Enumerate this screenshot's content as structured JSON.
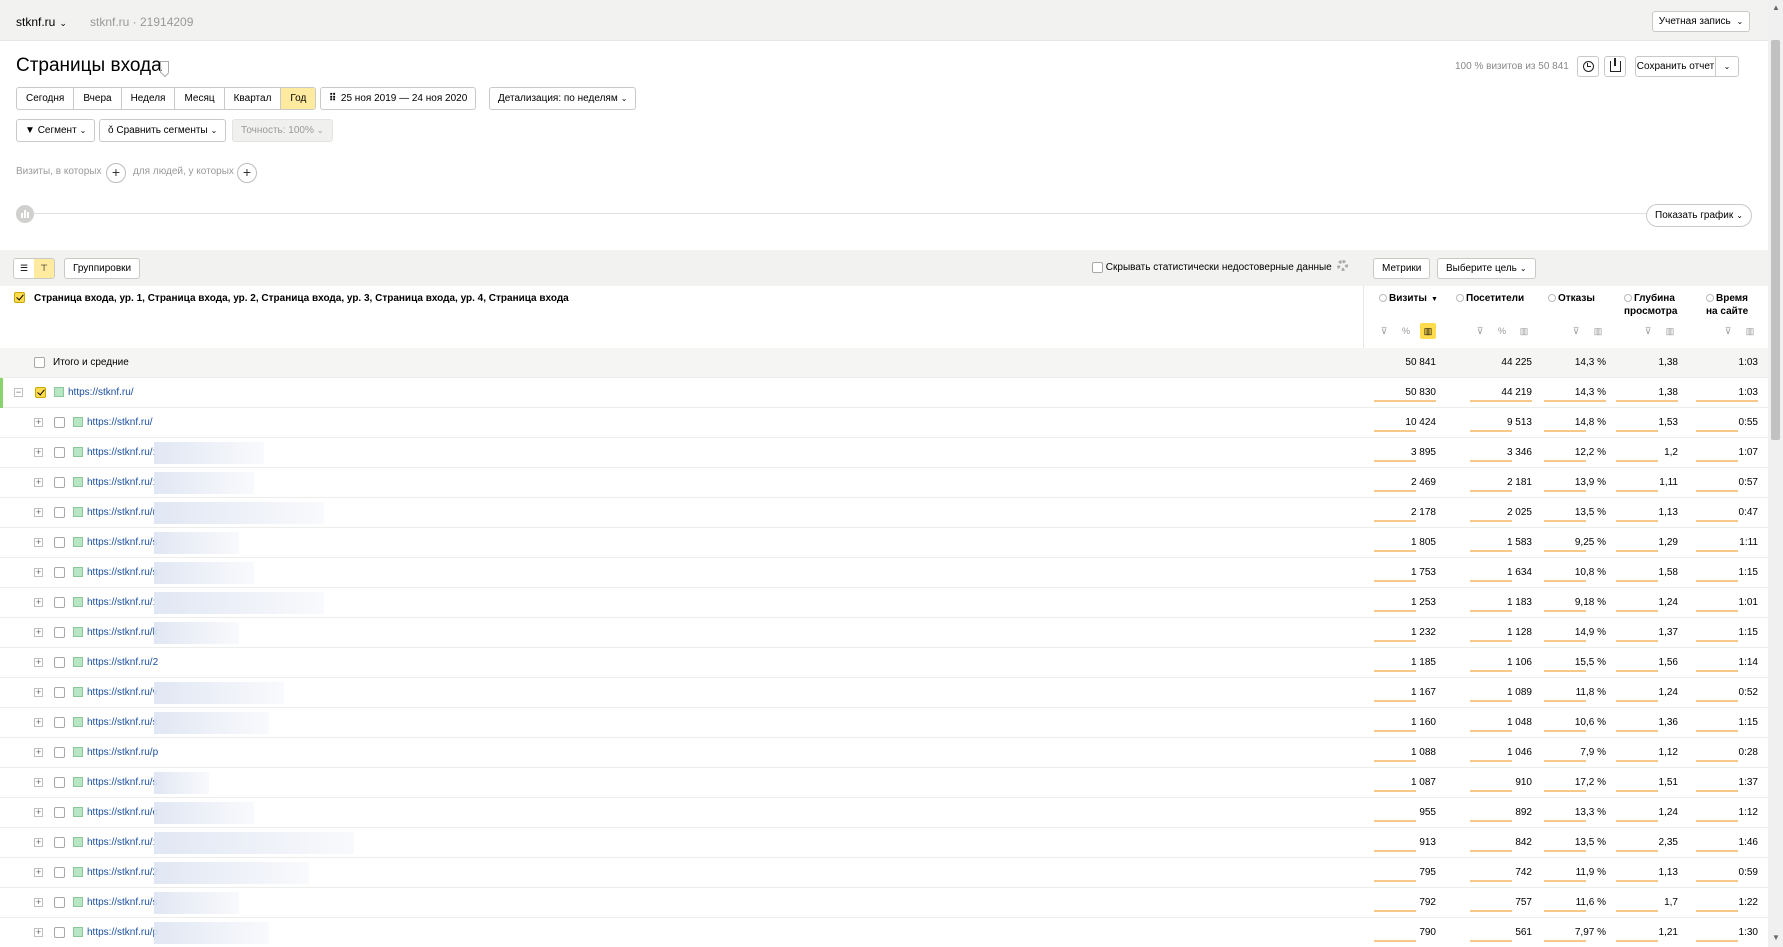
{
  "topbar": {
    "site": "stknf.ru",
    "counter": "stknf.ru · 21914209",
    "account": "Учетная запись"
  },
  "header": {
    "title": "Страницы входа",
    "visits_info": "100 % визитов из 50 841",
    "save_report": "Сохранить отчет"
  },
  "periods": [
    "Сегодня",
    "Вчера",
    "Неделя",
    "Месяц",
    "Квартал",
    "Год"
  ],
  "active_period": "Год",
  "date_range": "25 ноя 2019 — 24 ноя 2020",
  "detail": "Детализация: по неделям",
  "segment": "Сегмент",
  "compare": "Сравнить сегменты",
  "accuracy": "Точность: 100%",
  "filters": {
    "visits_where": "Визиты, в которых",
    "people_where": "для людей, у которых"
  },
  "show_graph": "Показать график",
  "toolbar": {
    "groupings": "Группировки",
    "hide_stat": "Скрывать статистически недостоверные данные",
    "metrics": "Метрики",
    "goal": "Выберите цель"
  },
  "table": {
    "dimension_title": "Страница входа, ур. 1, Страница входа, ур. 2, Страница входа, ур. 3, Страница входа, ур. 4, Страница входа",
    "columns": [
      {
        "line1": "Визиты",
        "line2": "",
        "sort": "▼"
      },
      {
        "line1": "Посетители",
        "line2": ""
      },
      {
        "line1": "Отказы",
        "line2": ""
      },
      {
        "line1": "Глубина",
        "line2": "просмотра"
      },
      {
        "line1": "Время",
        "line2": "на сайте"
      }
    ],
    "total": {
      "label": "Итого и средние",
      "values": [
        "50 841",
        "44 225",
        "14,3 %",
        "1,38",
        "1:03"
      ]
    },
    "root": {
      "url": "https://stknf.ru/",
      "values": [
        "50 830",
        "44 219",
        "14,3 %",
        "1,38",
        "1:03"
      ]
    },
    "rows": [
      {
        "url": "https://stknf.ru/",
        "values": [
          "10 424",
          "9 513",
          "14,8 %",
          "1,53",
          "0:55"
        ]
      },
      {
        "url": "https://stknf.ru/:",
        "values": [
          "3 895",
          "3 346",
          "12,2 %",
          "1,2",
          "1:07"
        ]
      },
      {
        "url": "https://stknf.ru/:",
        "values": [
          "2 469",
          "2 181",
          "13,9 %",
          "1,11",
          "0:57"
        ]
      },
      {
        "url": "https://stknf.ru/r",
        "values": [
          "2 178",
          "2 025",
          "13,5 %",
          "1,13",
          "0:47"
        ]
      },
      {
        "url": "https://stknf.ru/s",
        "values": [
          "1 805",
          "1 583",
          "9,25 %",
          "1,29",
          "1:11"
        ]
      },
      {
        "url": "https://stknf.ru/s",
        "values": [
          "1 753",
          "1 634",
          "10,8 %",
          "1,58",
          "1:15"
        ]
      },
      {
        "url": "https://stknf.ru/:",
        "values": [
          "1 253",
          "1 183",
          "9,18 %",
          "1,24",
          "1:01"
        ]
      },
      {
        "url": "https://stknf.ru/k",
        "values": [
          "1 232",
          "1 128",
          "14,9 %",
          "1,37",
          "1:15"
        ]
      },
      {
        "url": "https://stknf.ru/2",
        "values": [
          "1 185",
          "1 106",
          "15,5 %",
          "1,56",
          "1:14"
        ]
      },
      {
        "url": "https://stknf.ru/v",
        "values": [
          "1 167",
          "1 089",
          "11,8 %",
          "1,24",
          "0:52"
        ]
      },
      {
        "url": "https://stknf.ru/s",
        "values": [
          "1 160",
          "1 048",
          "10,6 %",
          "1,36",
          "1:15"
        ]
      },
      {
        "url": "https://stknf.ru/p",
        "values": [
          "1 088",
          "1 046",
          "7,9 %",
          "1,12",
          "0:28"
        ]
      },
      {
        "url": "https://stknf.ru/s",
        "values": [
          "1 087",
          "910",
          "17,2 %",
          "1,51",
          "1:37"
        ]
      },
      {
        "url": "https://stknf.ru/c",
        "values": [
          "955",
          "892",
          "13,3 %",
          "1,24",
          "1:12"
        ]
      },
      {
        "url": "https://stknf.ru/:",
        "values": [
          "913",
          "842",
          "13,5 %",
          "2,35",
          "1:46"
        ]
      },
      {
        "url": "https://stknf.ru/2",
        "values": [
          "795",
          "742",
          "11,9 %",
          "1,13",
          "0:59"
        ]
      },
      {
        "url": "https://stknf.ru/s",
        "values": [
          "792",
          "757",
          "11,6 %",
          "1,7",
          "1:22"
        ]
      },
      {
        "url": "https://stknf.ru/p",
        "values": [
          "790",
          "561",
          "7,97 %",
          "1,21",
          "1:30"
        ]
      }
    ]
  },
  "colors": {
    "accent": "#ffdb4d",
    "active_bg": "#ffeba0",
    "link": "#1a4fa0",
    "bar": "#f8c78a",
    "row_marker": "#8ad26c"
  }
}
